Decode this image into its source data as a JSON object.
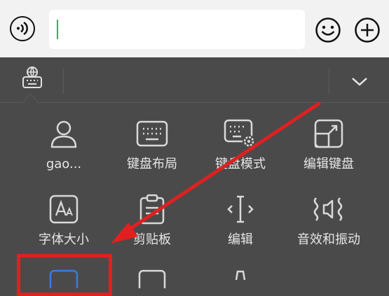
{
  "chat_input": {
    "value": ""
  },
  "keyboard": {
    "functions": [
      {
        "label": "gao...",
        "icon": "user-icon"
      },
      {
        "label": "键盘布局",
        "icon": "keyboard-layout-icon"
      },
      {
        "label": "键盘模式",
        "icon": "keyboard-settings-icon"
      },
      {
        "label": "编辑键盘",
        "icon": "edit-keyboard-icon"
      },
      {
        "label": "字体大小",
        "icon": "font-size-icon"
      },
      {
        "label": "剪贴板",
        "icon": "clipboard-icon"
      },
      {
        "label": "编辑",
        "icon": "cursor-edit-icon"
      },
      {
        "label": "音效和振动",
        "icon": "sound-vibration-icon"
      }
    ]
  },
  "colors": {
    "panel_bg": "#4a4a4a",
    "icon": "#d9d9d9",
    "highlight": "#e02020",
    "caret": "#07c160"
  }
}
